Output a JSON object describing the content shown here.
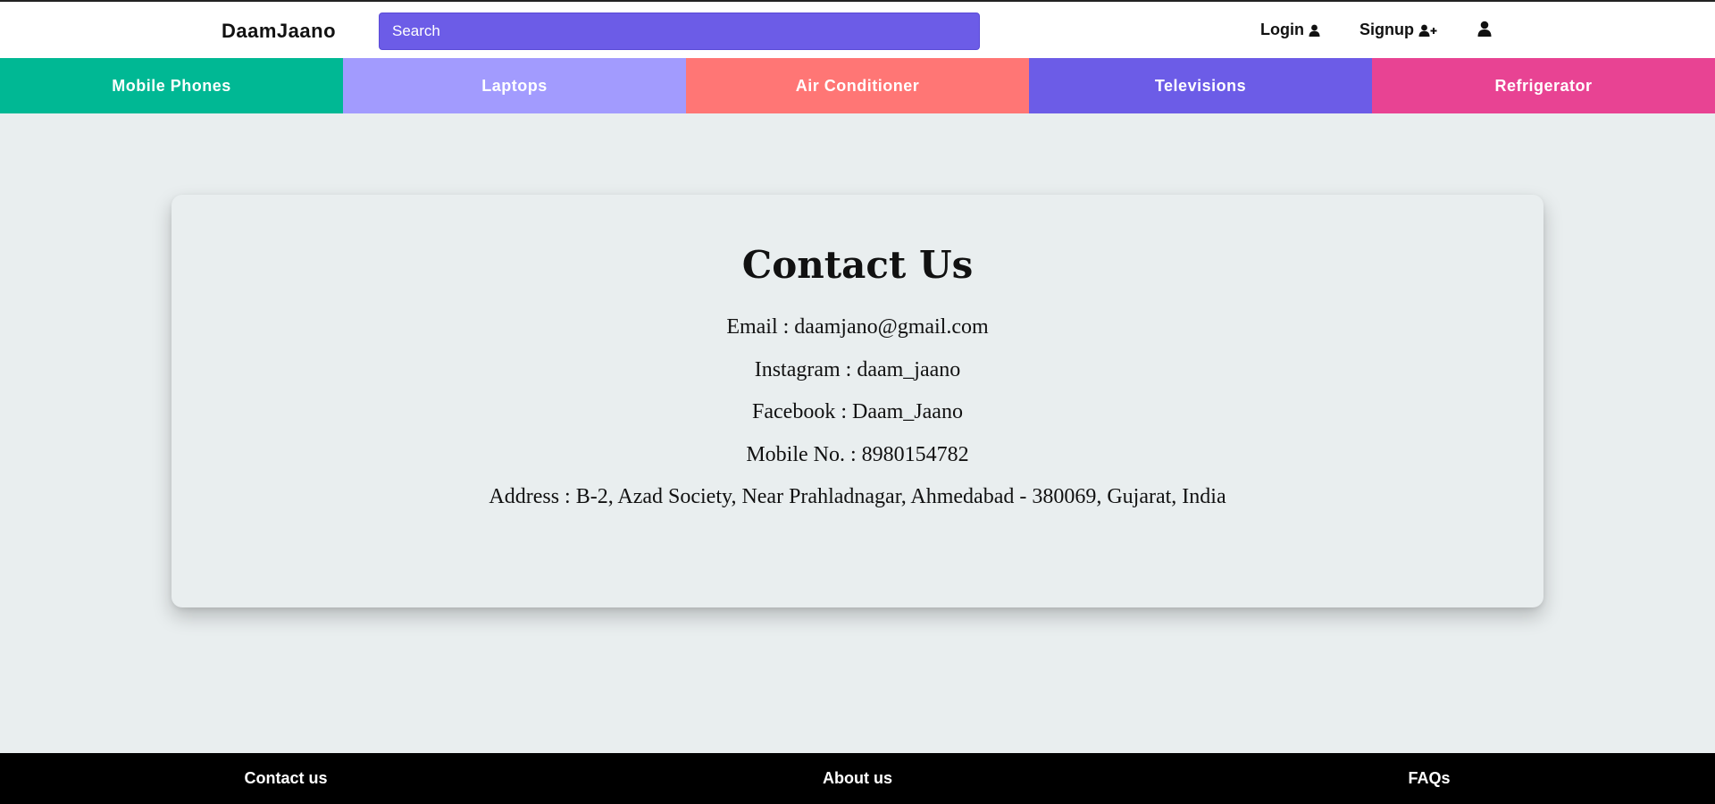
{
  "header": {
    "brand": "DaamJaano",
    "search": {
      "placeholder": "Search",
      "value": ""
    },
    "login_label": "Login",
    "signup_label": "Signup"
  },
  "categories": [
    {
      "label": "Mobile Phones",
      "color": "#00b894"
    },
    {
      "label": "Laptops",
      "color": "#a29bfe"
    },
    {
      "label": "Air Conditioner",
      "color": "#ff7675"
    },
    {
      "label": "Televisions",
      "color": "#6c5ce7"
    },
    {
      "label": "Refrigerator",
      "color": "#e84393"
    }
  ],
  "contact": {
    "title": "Contact Us",
    "email": "Email : daamjano@gmail.com",
    "instagram": "Instagram : daam_jaano",
    "facebook": "Facebook : Daam_Jaano",
    "mobile": "Mobile No. : 8980154782",
    "address": "Address : B-2, Azad Society, Near Prahladnagar, Ahmedabad - 380069, Gujarat, India"
  },
  "footer": {
    "links": [
      "Contact us",
      "About us",
      "FAQs"
    ]
  },
  "icons": {
    "login": "user-icon",
    "signup": "user-plus-icon",
    "account": "user-icon"
  },
  "colors": {
    "search_bg": "#6c5ce7",
    "page_bg": "#e9eeef",
    "footer_bg": "#000000"
  }
}
